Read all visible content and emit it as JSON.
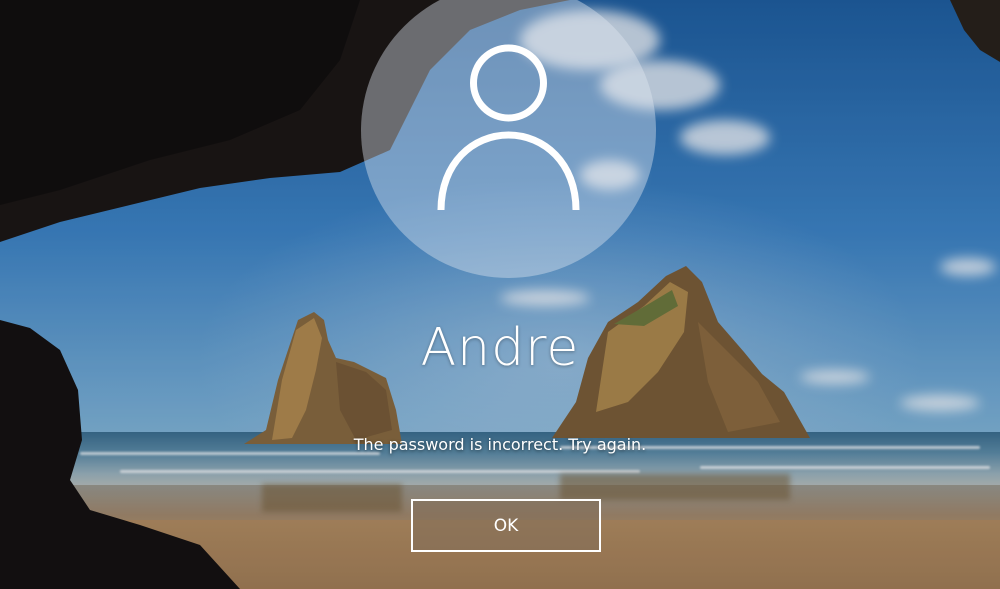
{
  "lock_screen": {
    "user_name": "Andre",
    "error_message": "The password is incorrect. Try again.",
    "ok_label": "OK",
    "avatar_icon": "user-silhouette-icon"
  },
  "colors": {
    "text": "#ffffff",
    "avatar_fill": "rgba(225,232,240,0.42)",
    "button_border": "#ffffff"
  }
}
